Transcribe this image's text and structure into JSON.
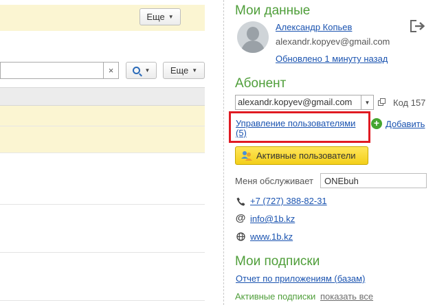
{
  "left": {
    "more_button_top": "Еще",
    "search": {
      "value": "",
      "clear_glyph": "×"
    },
    "more_button_search": "Еще"
  },
  "profile": {
    "heading": "Мои данные",
    "user_name": "Александр Копьев",
    "email": "alexandr.kopyev@gmail.com",
    "updated": "Обновлено 1 минуту назад"
  },
  "subscriber": {
    "heading": "Абонент",
    "account_value": "alexandr.kopyev@gmail.com",
    "code": "Код 157",
    "manage_users_line1": "Управление пользователями",
    "manage_users_line2": "(5)",
    "add_label": "Добавить",
    "active_users_button": "Активные пользователи",
    "served_by_label": "Меня обслуживает",
    "served_by_value": "ONEbuh",
    "phone": "+7 (727) 388-82-31",
    "email_contact": "info@1b.kz",
    "website": "www.1b.kz"
  },
  "subscriptions": {
    "heading": "Мои подписки",
    "report_link": "Отчет по приложениям (базам)",
    "active_label": "Активные подписки",
    "show_all": "показать все"
  },
  "colors": {
    "heading_green": "#4f9e3a",
    "link_blue": "#1a53b0",
    "highlight_red": "#e01a22",
    "yellow_button": "#f3cf1a",
    "row_yellow": "#fbf5d2"
  }
}
